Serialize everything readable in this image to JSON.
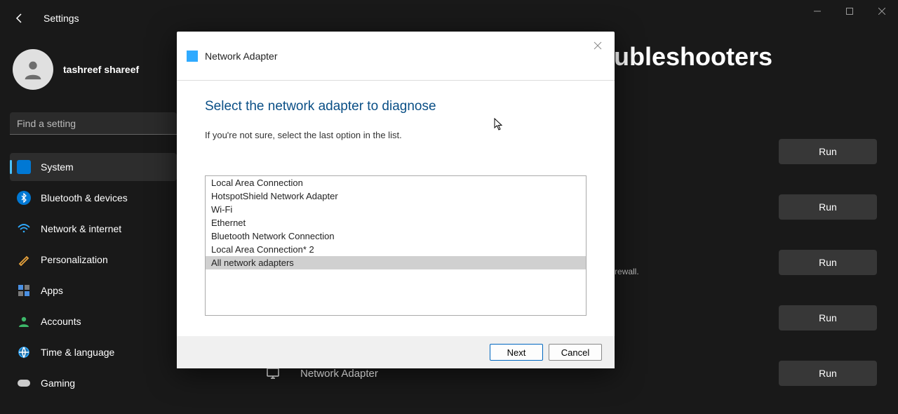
{
  "window": {
    "app_title": "Settings"
  },
  "user": {
    "name": "tashreef shareef"
  },
  "search": {
    "placeholder": "Find a setting"
  },
  "nav": {
    "items": [
      {
        "label": "System",
        "icon": "system"
      },
      {
        "label": "Bluetooth & devices",
        "icon": "bluetooth"
      },
      {
        "label": "Network & internet",
        "icon": "wifi"
      },
      {
        "label": "Personalization",
        "icon": "brush"
      },
      {
        "label": "Apps",
        "icon": "apps"
      },
      {
        "label": "Accounts",
        "icon": "person"
      },
      {
        "label": "Time & language",
        "icon": "globe"
      },
      {
        "label": "Gaming",
        "icon": "gamepad"
      }
    ],
    "active_index": 0
  },
  "page": {
    "title_fragment": "ubleshooters",
    "side_text_fragment": "rewall.",
    "run_button_label": "Run",
    "adapter_row_label": "Network Adapter"
  },
  "dialog": {
    "header_title": "Network Adapter",
    "title": "Select the network adapter to diagnose",
    "subtitle": "If you're not sure, select the last option in the list.",
    "options": [
      "Local Area Connection",
      "HotspotShield Network Adapter",
      "Wi-Fi",
      "Ethernet",
      "Bluetooth Network Connection",
      "Local Area Connection* 2",
      "All network adapters"
    ],
    "selected_index": 6,
    "next_label": "Next",
    "cancel_label": "Cancel"
  }
}
